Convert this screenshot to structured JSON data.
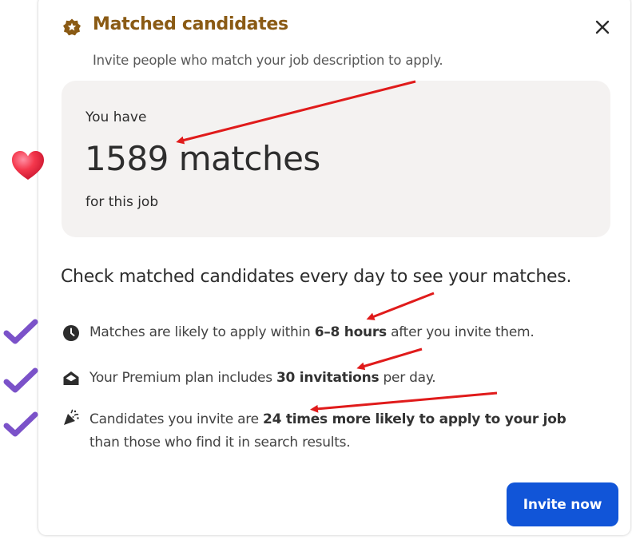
{
  "modal": {
    "title": "Matched candidates",
    "subtitle": "Invite people who match your job description to apply.",
    "close_icon": "close-icon"
  },
  "match_card": {
    "prefix": "You have",
    "count": "1589 matches",
    "suffix": "for this job"
  },
  "heading": "Check matched candidates every day to see your matches.",
  "benefits": [
    {
      "icon": "clock-icon",
      "text_before": "Matches are likely to apply within ",
      "highlight": "6–8 hours",
      "text_after": " after you invite them.",
      "line2": ""
    },
    {
      "icon": "envelope-icon",
      "text_before": "Your Premium plan includes ",
      "highlight": "30 invitations",
      "text_after": " per day.",
      "line2": ""
    },
    {
      "icon": "party-popper-icon",
      "text_before": "Candidates you invite are ",
      "highlight": "24 times more likely to apply to your job",
      "text_after": "",
      "line2": "than those who find it in search results."
    }
  ],
  "actions": {
    "invite_label": "Invite now"
  },
  "colors": {
    "title": "#8a5a14",
    "card_bg": "#f4f2f1",
    "primary_button": "#1155d8",
    "annotation_arrow": "#e01b1b",
    "checkmark": "#7b52c9"
  }
}
